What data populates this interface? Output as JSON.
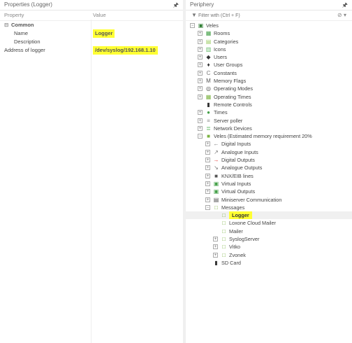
{
  "properties": {
    "title": "Properties (Logger)",
    "col_property": "Property",
    "col_value": "Value",
    "group": "Common",
    "rows": [
      {
        "key": "Name",
        "value": "Logger",
        "highlight": true
      },
      {
        "key": "Description",
        "value": "",
        "highlight": false
      },
      {
        "key": "Address of logger",
        "value": "/dev/syslog/192.168.1.10",
        "highlight": true
      }
    ]
  },
  "periphery": {
    "title": "Periphery",
    "filter_placeholder": "Filter with (Ctrl + F)",
    "tree": [
      {
        "label": "Veles",
        "level": 0,
        "exp": "-",
        "icon": "project-icon",
        "color": "#2e7d32"
      },
      {
        "label": "Rooms",
        "level": 1,
        "exp": "+",
        "icon": "rooms-icon",
        "color": "#43a047"
      },
      {
        "label": "Categories",
        "level": 1,
        "exp": "+",
        "icon": "categories-icon",
        "color": "#9ccc65"
      },
      {
        "label": "Icons",
        "level": 1,
        "exp": "+",
        "icon": "icons-icon",
        "color": "#66bb6a"
      },
      {
        "label": "Users",
        "level": 1,
        "exp": "+",
        "icon": "user-icon",
        "color": "#333333"
      },
      {
        "label": "User Groups",
        "level": 1,
        "exp": "+",
        "icon": "user-group-icon",
        "color": "#333333"
      },
      {
        "label": "Constants",
        "level": 1,
        "exp": "+",
        "icon": "constant-icon",
        "color": "#777777"
      },
      {
        "label": "Memory Flags",
        "level": 1,
        "exp": "+",
        "icon": "memory-flag-icon",
        "color": "#555555"
      },
      {
        "label": "Operating Modes",
        "level": 1,
        "exp": "+",
        "icon": "operating-mode-icon",
        "color": "#444444"
      },
      {
        "label": "Operating Times",
        "level": 1,
        "exp": "+",
        "icon": "calendar-icon",
        "color": "#7cb342"
      },
      {
        "label": "Remote Controls",
        "level": 1,
        "exp": "",
        "icon": "remote-control-icon",
        "color": "#333333"
      },
      {
        "label": "Times",
        "level": 1,
        "exp": "+",
        "icon": "clock-icon",
        "color": "#43a047"
      },
      {
        "label": "Server poller",
        "level": 1,
        "exp": "+",
        "icon": "server-icon",
        "color": "#888888"
      },
      {
        "label": "Network Devices",
        "level": 1,
        "exp": "+",
        "icon": "network-icon",
        "color": "#66bb6a"
      },
      {
        "label": "Veles (Estimated memory requirement 20%",
        "level": 1,
        "exp": "-",
        "icon": "miniserver-icon",
        "color": "#7cb342"
      },
      {
        "label": "Digital Inputs",
        "level": 2,
        "exp": "+",
        "icon": "digital-input-icon",
        "color": "#777777"
      },
      {
        "label": "Analogue Inputs",
        "level": 2,
        "exp": "+",
        "icon": "analogue-input-icon",
        "color": "#777777"
      },
      {
        "label": "Digital Outputs",
        "level": 2,
        "exp": "+",
        "icon": "digital-output-icon",
        "color": "#e53935"
      },
      {
        "label": "Analogue Outputs",
        "level": 2,
        "exp": "+",
        "icon": "analogue-output-icon",
        "color": "#777777"
      },
      {
        "label": "KNX/EIB lines",
        "level": 2,
        "exp": "+",
        "icon": "knx-icon",
        "color": "#555555"
      },
      {
        "label": "Virtual Inputs",
        "level": 2,
        "exp": "+",
        "icon": "virtual-input-icon",
        "color": "#43a047"
      },
      {
        "label": "Virtual Outputs",
        "level": 2,
        "exp": "+",
        "icon": "virtual-output-icon",
        "color": "#43a047"
      },
      {
        "label": "Miniserver Communication",
        "level": 2,
        "exp": "+",
        "icon": "communication-icon",
        "color": "#555555"
      },
      {
        "label": "Messages",
        "level": 2,
        "exp": "-",
        "icon": "messages-icon",
        "color": "#7cb342"
      },
      {
        "label": "Logger",
        "level": 3,
        "exp": "",
        "icon": "logger-icon",
        "color": "#7cb342",
        "selected": true
      },
      {
        "label": "Loxone Cloud Mailer",
        "level": 3,
        "exp": "",
        "icon": "cloud-mailer-icon",
        "color": "#7cb342"
      },
      {
        "label": "Mailer",
        "level": 3,
        "exp": "",
        "icon": "mailer-icon",
        "color": "#7cb342"
      },
      {
        "label": "SyslogServer",
        "level": 3,
        "exp": "+",
        "icon": "syslog-icon",
        "color": "#7cb342"
      },
      {
        "label": "Vitko",
        "level": 3,
        "exp": "+",
        "icon": "message-icon",
        "color": "#7cb342"
      },
      {
        "label": "Zvonek",
        "level": 3,
        "exp": "+",
        "icon": "message-icon",
        "color": "#7cb342"
      },
      {
        "label": "SD Card",
        "level": 2,
        "exp": "",
        "icon": "sd-card-icon",
        "color": "#333333"
      }
    ]
  }
}
